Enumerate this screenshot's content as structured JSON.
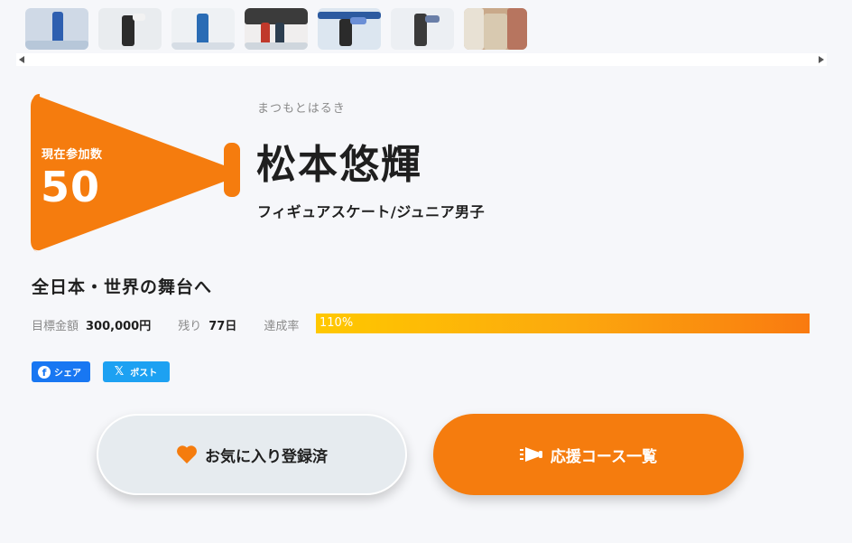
{
  "gallery": {
    "thumbnails": [
      {
        "name": "photo-1"
      },
      {
        "name": "photo-2"
      },
      {
        "name": "photo-3"
      },
      {
        "name": "photo-4"
      },
      {
        "name": "photo-5"
      },
      {
        "name": "photo-6"
      },
      {
        "name": "photo-7"
      }
    ]
  },
  "badge": {
    "label": "現在参加数",
    "count": "50",
    "color": "#f57c0e"
  },
  "athlete": {
    "kana": "まつもとはるき",
    "name": "松本悠輝",
    "category": "フィギュアスケート/ジュニア男子"
  },
  "project": {
    "headline": "全日本・世界の舞台へ",
    "goal_label": "目標金額",
    "goal_value": "300,000円",
    "remaining_label": "残り",
    "remaining_value": "77日",
    "progress_label": "達成率",
    "progress_text": "110%",
    "progress_fraction": 1.0
  },
  "share": {
    "facebook_label": "シェア",
    "x_label": "ポスト"
  },
  "actions": {
    "favorite_label": "お気に入り登録済",
    "course_label": "応援コース一覧"
  },
  "colors": {
    "accent": "#f57c0e",
    "progress_start": "#ffc800",
    "progress_end": "#f97a10",
    "facebook": "#1877f2",
    "x": "#1da1f2"
  }
}
